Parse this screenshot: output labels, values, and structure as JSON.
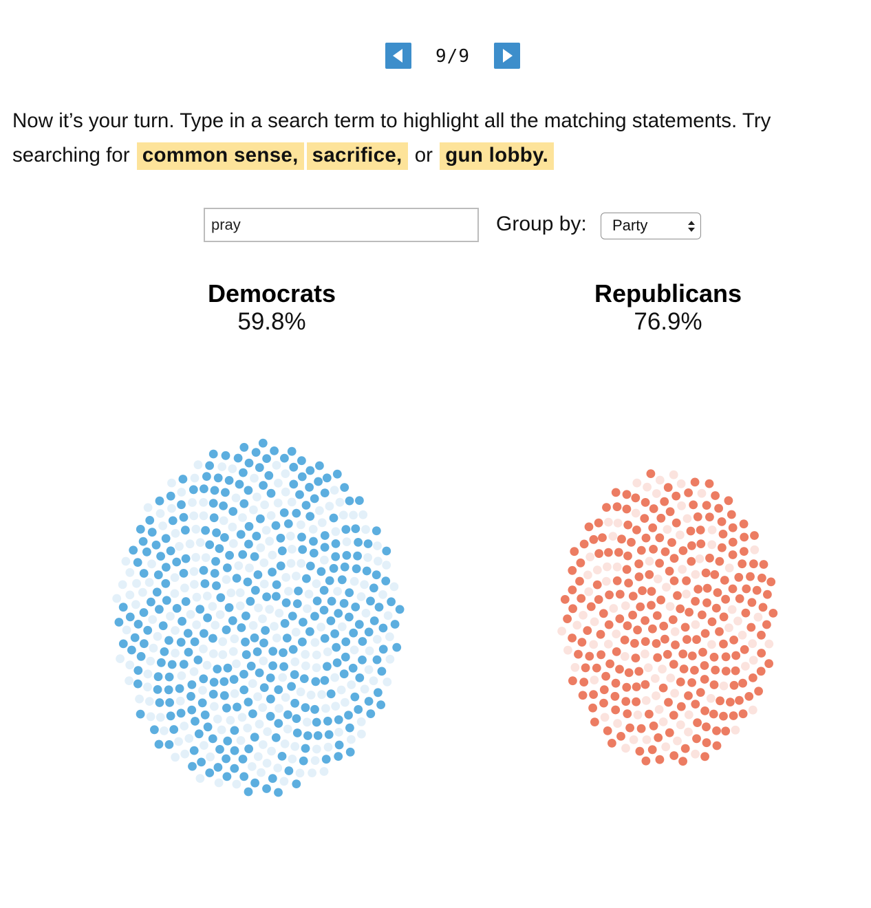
{
  "pager": {
    "label": "9/9",
    "prev_icon": "triangle-left-icon",
    "next_icon": "triangle-right-icon",
    "button_color": "#3d8ecb"
  },
  "intro": {
    "text_before": "Now it’s your turn. Type in a search term to highlight all the matching statements. Try searching for",
    "term1": "common sense,",
    "term2": "sacrifice,",
    "or_text": "or",
    "term3": "gun lobby.",
    "highlight_color": "#fde39a"
  },
  "search": {
    "value": "pray"
  },
  "group_by": {
    "label": "Group by:",
    "selected": "Party",
    "icon": "select-arrows-icon"
  },
  "chart_data": {
    "type": "scatter",
    "series": [
      {
        "name": "Democrats",
        "value_label": "59.8%",
        "share": 0.598,
        "dot_count": 560,
        "highlight_color": "#5caedf",
        "faded_color": "#e3f0f9"
      },
      {
        "name": "Republicans",
        "value_label": "76.9%",
        "share": 0.769,
        "dot_count": 340,
        "highlight_color": "#ec7c62",
        "faded_color": "#fbe3de"
      }
    ]
  }
}
